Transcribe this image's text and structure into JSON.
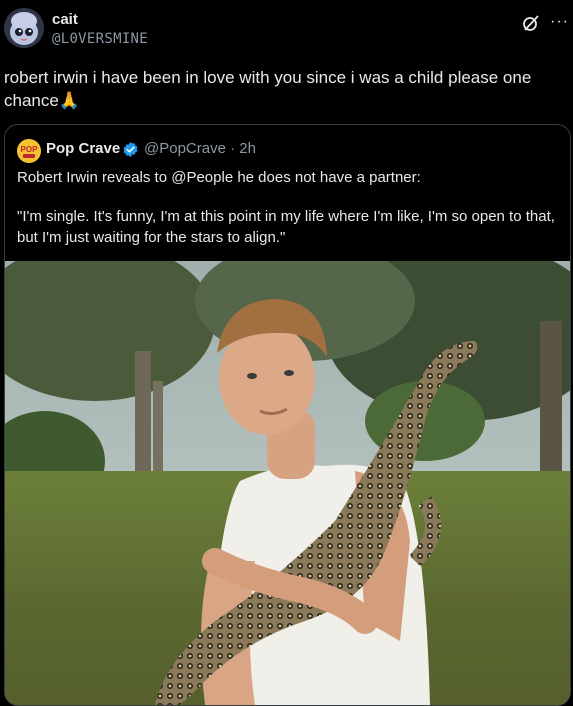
{
  "post": {
    "author_name": "cait",
    "author_handle": "@L0VERSMINE",
    "more_label": "···",
    "text": "robert irwin i have been in love with you since i was a child please one chance🙏"
  },
  "quote": {
    "author_name": "Pop Crave",
    "author_handle": "@PopCrave · 2h",
    "logo_text": "POP",
    "line1": "Robert Irwin reveals to @People he does not have a partner:",
    "line2": "\"I'm single. It's funny, I'm at this point in my life where I'm like, I'm so open to that, but I'm just waiting for the stars to align.\""
  },
  "colors": {
    "background": "#000000",
    "text_primary": "#e7e9ea",
    "text_secondary": "#8b98a5",
    "verified_badge": "#1d9bf0",
    "border": "#3a3f45",
    "pop_crave_yellow": "#f2c230"
  },
  "icons": {
    "grok": "grok-icon",
    "more": "more-icon",
    "verified": "verified-badge-icon"
  }
}
